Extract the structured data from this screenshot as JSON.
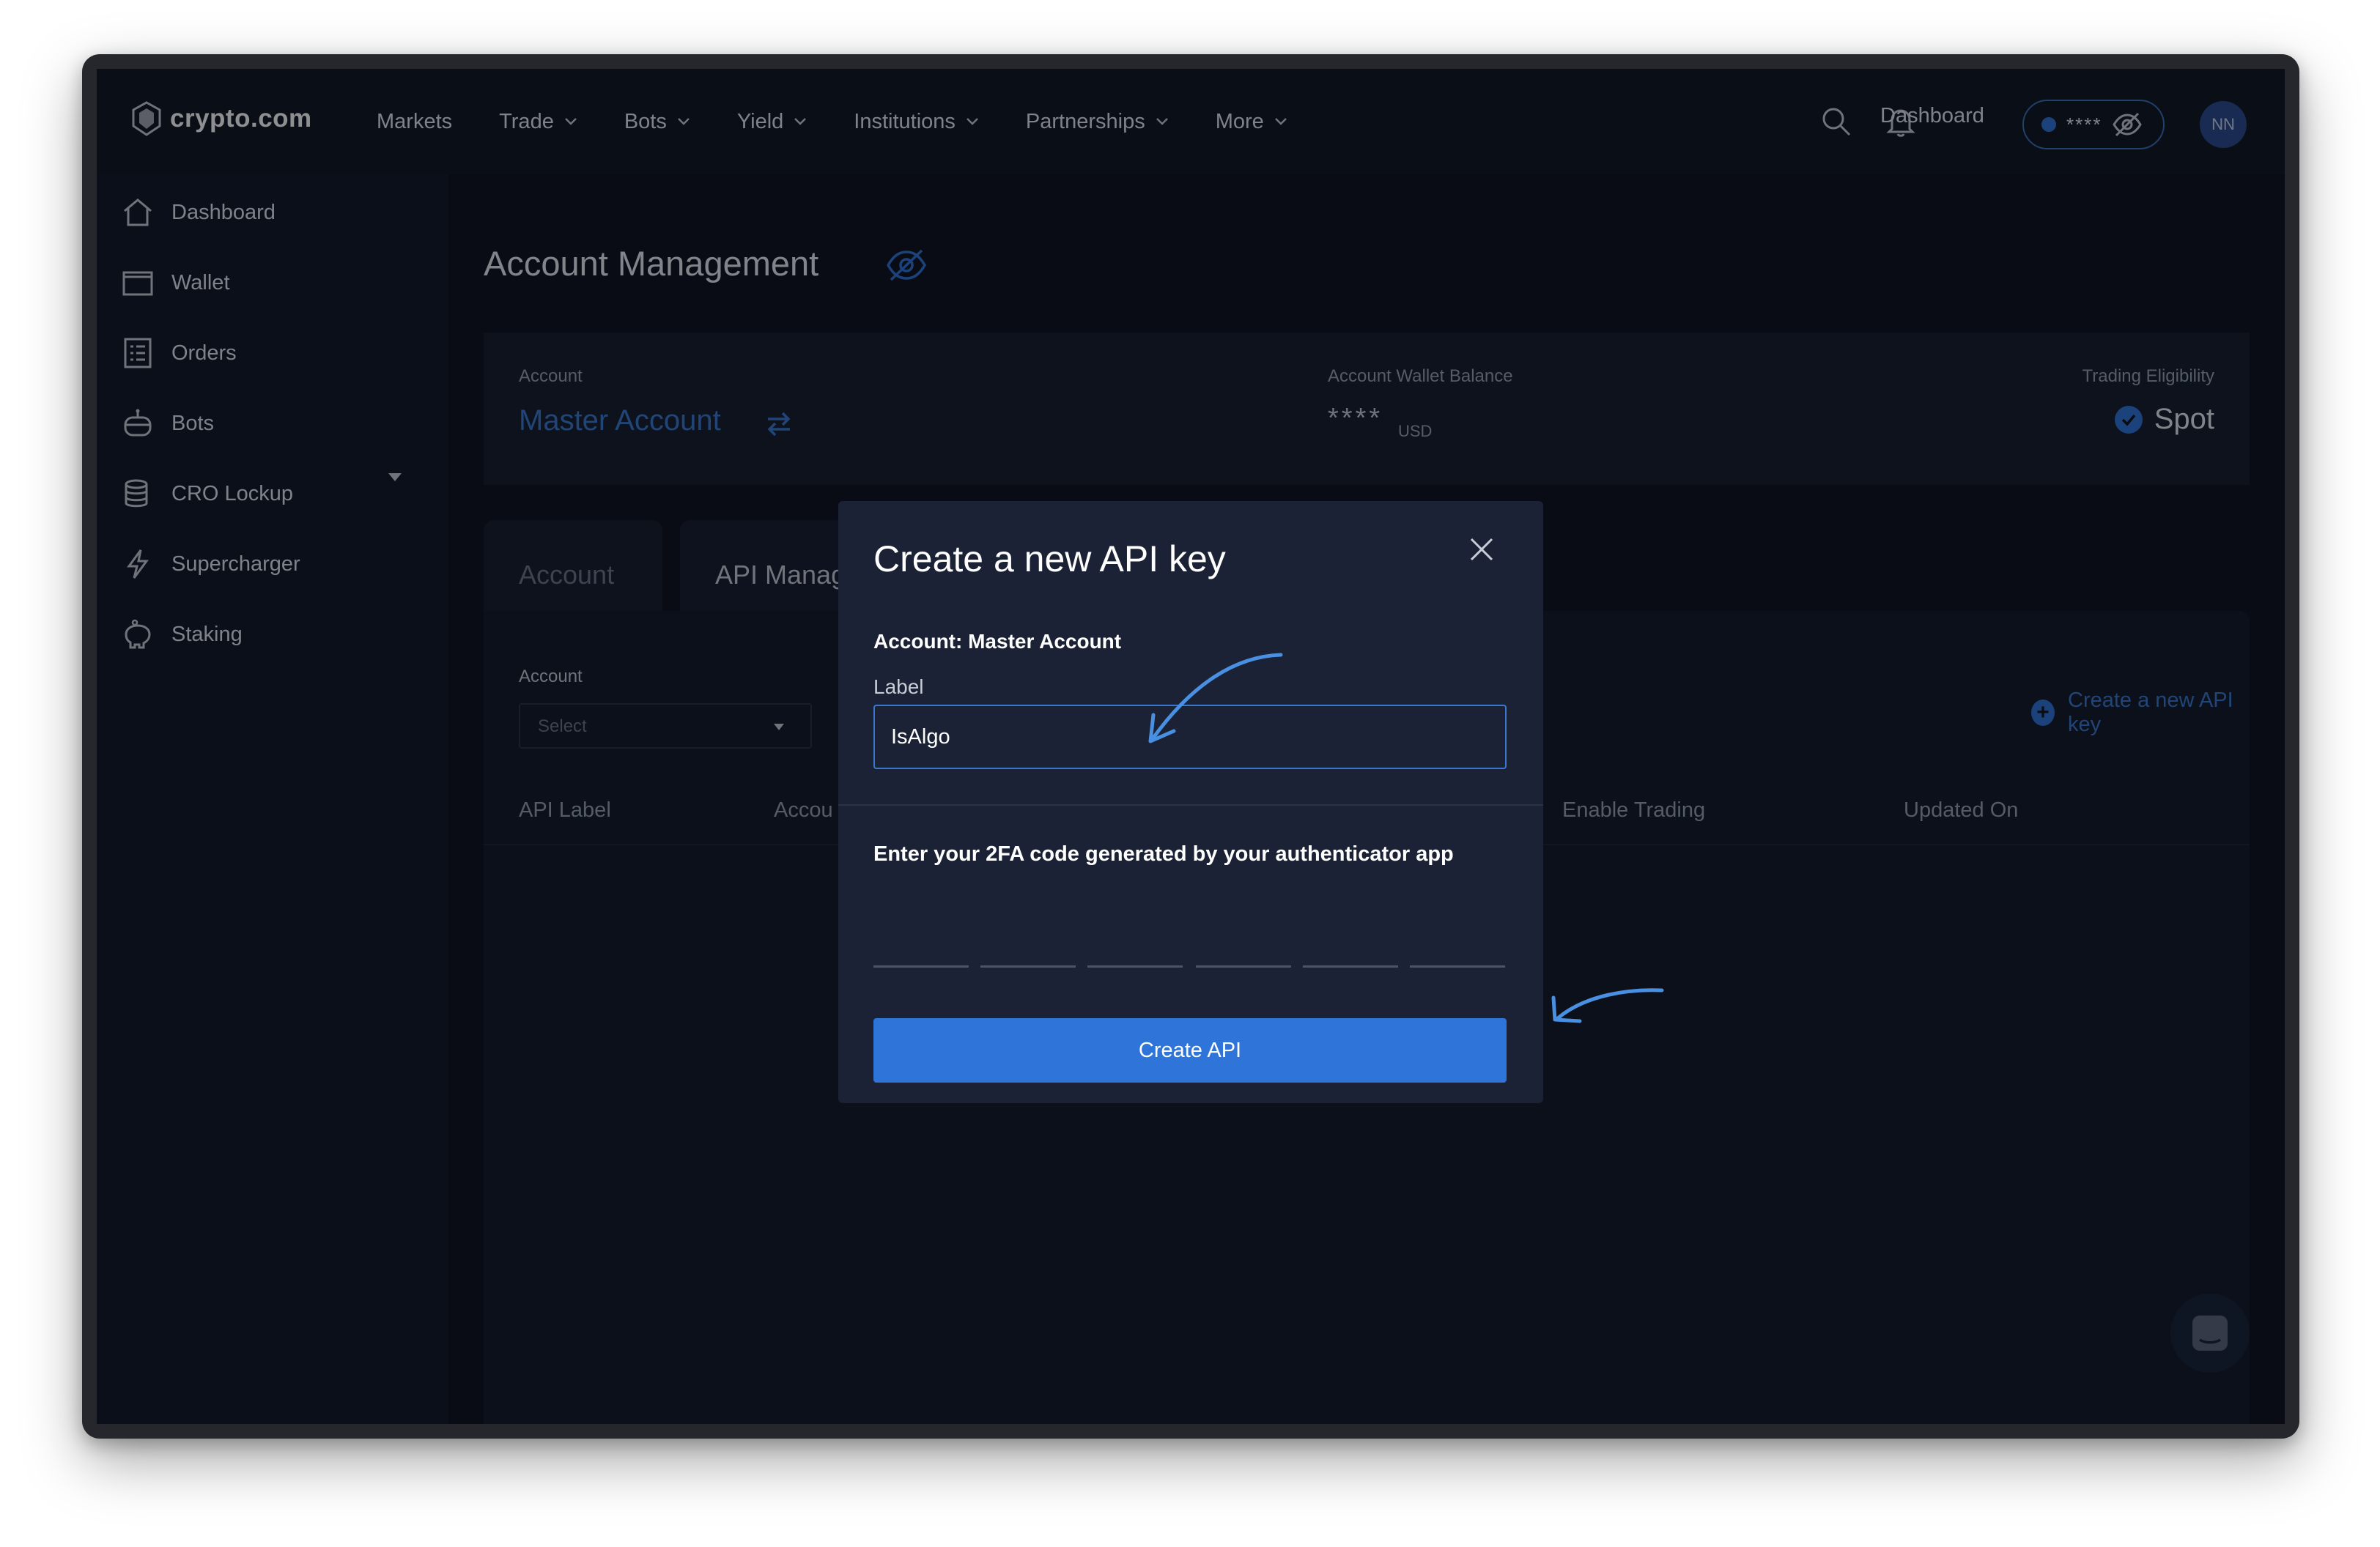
{
  "brand": {
    "logo_text": "crypto.com"
  },
  "topnav": {
    "items": [
      {
        "label": "Markets",
        "has_dropdown": false
      },
      {
        "label": "Trade",
        "has_dropdown": true
      },
      {
        "label": "Bots",
        "has_dropdown": true
      },
      {
        "label": "Yield",
        "has_dropdown": true
      },
      {
        "label": "Institutions",
        "has_dropdown": true
      },
      {
        "label": "Partnerships",
        "has_dropdown": true
      },
      {
        "label": "More",
        "has_dropdown": true
      }
    ],
    "dashboard_label": "Dashboard",
    "balance_masked": "****",
    "avatar_initials": "NN",
    "icons": [
      "search-icon",
      "bell-icon",
      "eye-slash-icon"
    ]
  },
  "sidebar": {
    "items": [
      {
        "label": "Dashboard",
        "icon": "home-icon"
      },
      {
        "label": "Wallet",
        "icon": "wallet-icon"
      },
      {
        "label": "Orders",
        "icon": "orders-icon"
      },
      {
        "label": "Bots",
        "icon": "bot-icon"
      },
      {
        "label": "CRO Lockup",
        "icon": "database-icon"
      },
      {
        "label": "Supercharger",
        "icon": "lightning-icon"
      },
      {
        "label": "Staking",
        "icon": "piggy-bank-icon"
      }
    ]
  },
  "page": {
    "title": "Account Management",
    "account_card": {
      "account_label": "Account",
      "account_value": "Master Account",
      "balance_label": "Account Wallet Balance",
      "balance_value": "****",
      "balance_currency": "USD",
      "eligibility_label": "Trading Eligibility",
      "eligibility_value": "Spot"
    },
    "tabs": [
      {
        "label": "Account",
        "active": false
      },
      {
        "label": "API Manag",
        "active": true
      }
    ],
    "panel": {
      "account_filter_label": "Account",
      "select_placeholder": "Select",
      "create_link": "Create a new API key",
      "columns": [
        "API Label",
        "Accou",
        "Enable Trading",
        "Updated On"
      ]
    }
  },
  "modal": {
    "title": "Create a new API key",
    "account_line": "Account: Master Account",
    "label_field_label": "Label",
    "label_value": "IsAlgo",
    "tfa_instruction": "Enter your 2FA code generated by your authenticator app",
    "otp_digits": 6,
    "submit_label": "Create API"
  },
  "colors": {
    "background": "#0d121e",
    "accent": "#2f74d8",
    "link": "#3a78d0",
    "modal_bg": "#1b2235",
    "annotation_arrow": "#4a90e2"
  }
}
